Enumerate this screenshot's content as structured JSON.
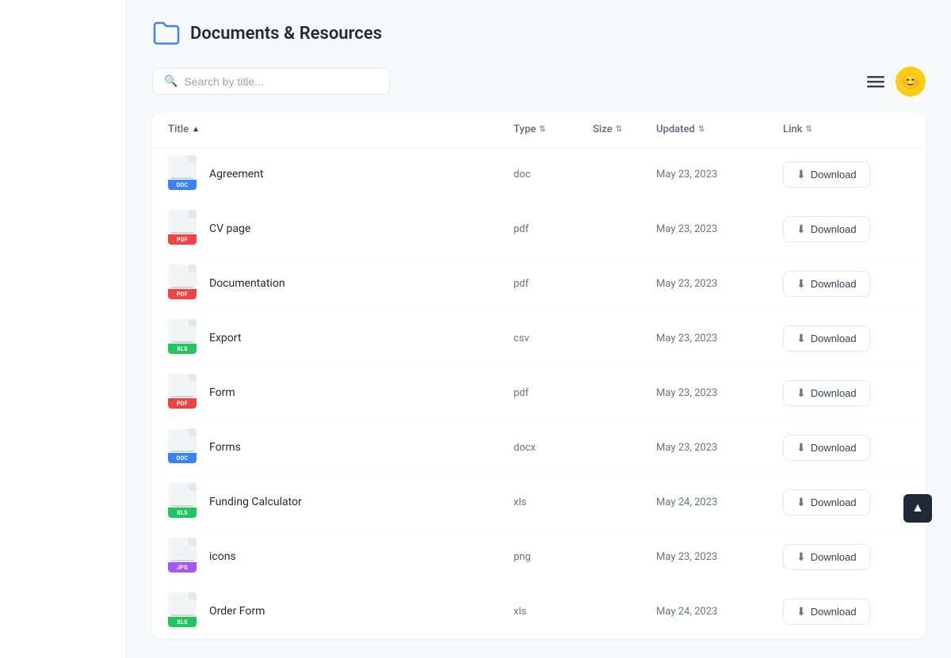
{
  "sidebar": {},
  "header": {
    "title": "Documents & Resources",
    "folder_icon": "📁"
  },
  "toolbar": {
    "search_placeholder": "Search by title...",
    "menu_label": "Menu",
    "avatar_label": "User Avatar"
  },
  "table": {
    "columns": [
      {
        "key": "title",
        "label": "Title",
        "sort": "asc"
      },
      {
        "key": "type",
        "label": "Type",
        "sort": "both"
      },
      {
        "key": "size",
        "label": "Size",
        "sort": "both"
      },
      {
        "key": "updated",
        "label": "Updated",
        "sort": "both"
      },
      {
        "key": "link",
        "label": "Link",
        "sort": "both"
      }
    ],
    "rows": [
      {
        "id": 1,
        "title": "Agreement",
        "type": "doc",
        "size": "",
        "updated": "May 23, 2023",
        "badge": "DOC",
        "badgeClass": "badge-doc"
      },
      {
        "id": 2,
        "title": "CV page",
        "type": "pdf",
        "size": "",
        "updated": "May 23, 2023",
        "badge": "PDF",
        "badgeClass": "badge-pdf"
      },
      {
        "id": 3,
        "title": "Documentation",
        "type": "pdf",
        "size": "",
        "updated": "May 23, 2023",
        "badge": "PDF",
        "badgeClass": "badge-pdf"
      },
      {
        "id": 4,
        "title": "Export",
        "type": "csv",
        "size": "",
        "updated": "May 23, 2023",
        "badge": "XLS",
        "badgeClass": "badge-xls"
      },
      {
        "id": 5,
        "title": "Form",
        "type": "pdf",
        "size": "",
        "updated": "May 23, 2023",
        "badge": "PDF",
        "badgeClass": "badge-pdf"
      },
      {
        "id": 6,
        "title": "Forms",
        "type": "docx",
        "size": "",
        "updated": "May 23, 2023",
        "badge": "DOC",
        "badgeClass": "badge-docx"
      },
      {
        "id": 7,
        "title": "Funding Calculator",
        "type": "xls",
        "size": "",
        "updated": "May 24, 2023",
        "badge": "XLS",
        "badgeClass": "badge-xls"
      },
      {
        "id": 8,
        "title": "icons",
        "type": "png",
        "size": "",
        "updated": "May 23, 2023",
        "badge": "JPG",
        "badgeClass": "badge-jpg"
      },
      {
        "id": 9,
        "title": "Order Form",
        "type": "xls",
        "size": "",
        "updated": "May 24, 2023",
        "badge": "XLS",
        "badgeClass": "badge-xls"
      }
    ],
    "download_label": "Download"
  },
  "scroll_top_label": "↑"
}
